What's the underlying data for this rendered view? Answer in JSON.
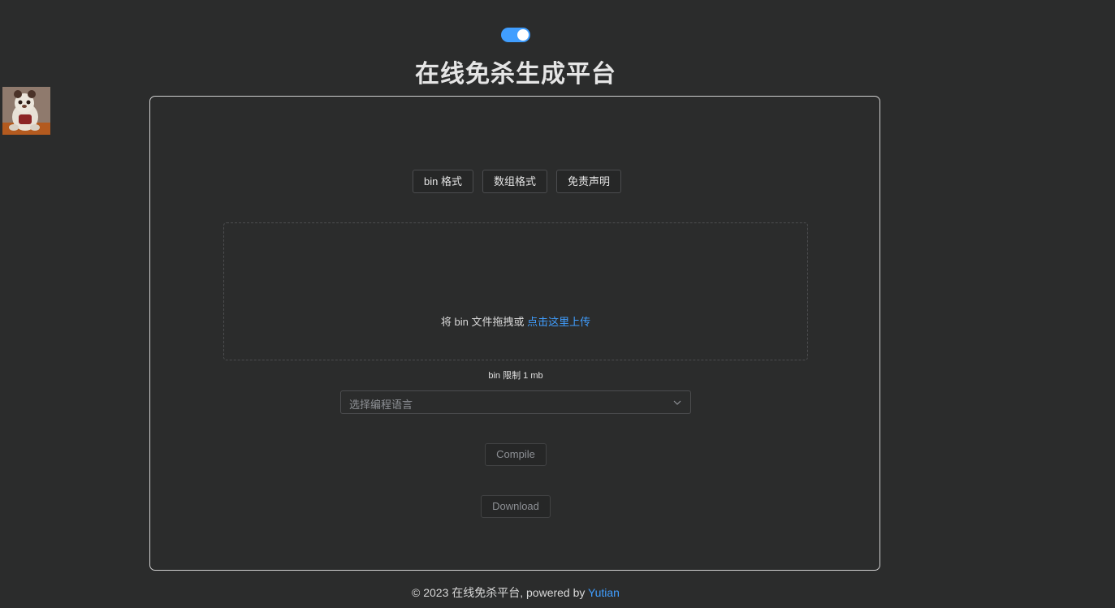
{
  "header": {
    "title": "在线免杀生成平台",
    "theme_toggle_on": true
  },
  "tabs": [
    {
      "label": "bin 格式"
    },
    {
      "label": "数组格式"
    },
    {
      "label": "免责声明"
    }
  ],
  "upload": {
    "prompt": "将 bin 文件拖拽或 ",
    "link": "点击这里上传",
    "tip": "bin 限制 1 mb"
  },
  "language_select": {
    "placeholder": "选择编程语言"
  },
  "actions": {
    "compile_label": "Compile",
    "download_label": "Download"
  },
  "footer": {
    "text": "© 2023 在线免杀平台, powered by ",
    "author": "Yutian"
  },
  "colors": {
    "background": "#2b2c2c",
    "accent": "#409eff",
    "border": "#4c4d4f"
  }
}
